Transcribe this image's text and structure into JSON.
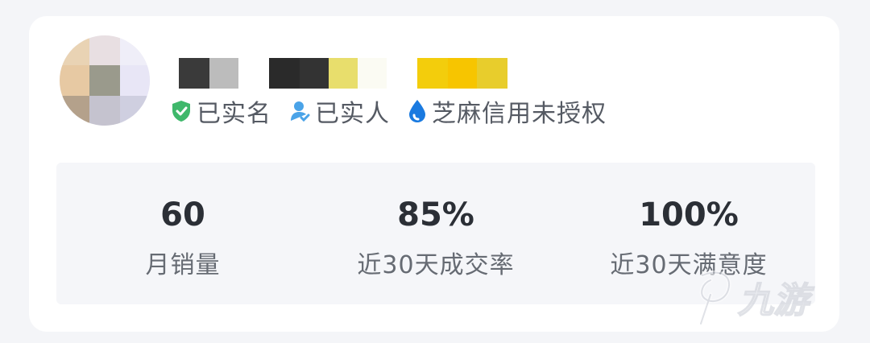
{
  "badges": {
    "real_name": "已实名",
    "real_person": "已实人",
    "sesame": "芝麻信用未授权"
  },
  "stats": [
    {
      "value": "60",
      "label": "月销量"
    },
    {
      "value": "85%",
      "label": "近30天成交率"
    },
    {
      "value": "100%",
      "label": "近30天满意度"
    }
  ],
  "watermark": {
    "text": "九游"
  },
  "colors": {
    "verified_green": "#3fb86b",
    "person_blue": "#4aa3e8",
    "sesame_blue": "#1a7ae0",
    "card_bg": "#ffffff",
    "page_bg": "#f4f5f8",
    "stats_bg": "#f5f6f9"
  }
}
